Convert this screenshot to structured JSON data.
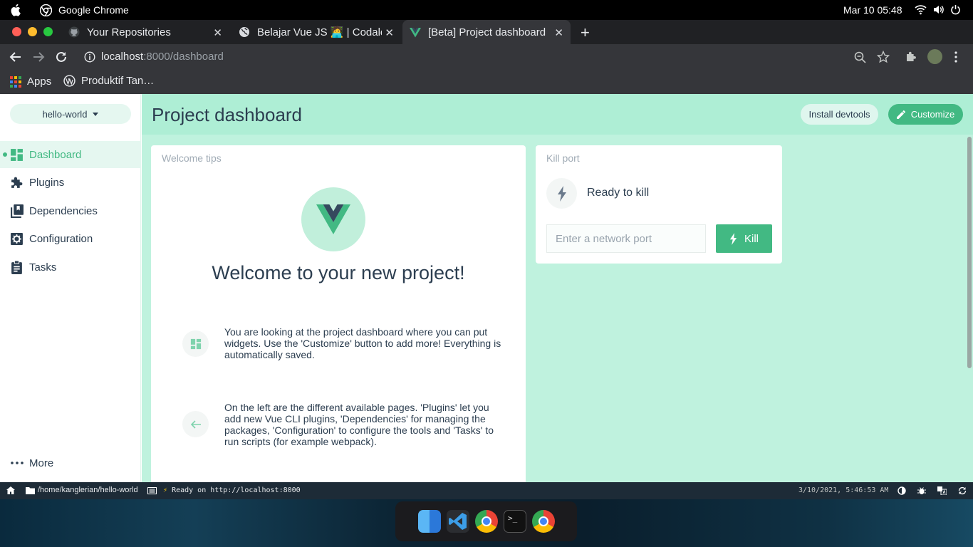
{
  "menubar": {
    "app_name": "Google Chrome",
    "datetime": "Mar 10  05:48"
  },
  "tabs": [
    {
      "label": "Your Repositories",
      "icon": "github-icon",
      "active": false
    },
    {
      "label": "Belajar Vue JS 🧑‍💻 | Codale",
      "icon": "globe-icon",
      "active": false
    },
    {
      "label": "[Beta] Project dashboard",
      "icon": "vue-icon",
      "active": true
    }
  ],
  "address": {
    "host": "localhost",
    "path": ":8000/dashboard"
  },
  "bookmarks": [
    {
      "label": "Apps",
      "icon": "apps-grid-icon"
    },
    {
      "label": "Produktif Tan…",
      "icon": "wordpress-icon"
    }
  ],
  "sidebar": {
    "project": "hello-world",
    "items": [
      {
        "label": "Dashboard",
        "icon": "dashboard-icon",
        "active": true
      },
      {
        "label": "Plugins",
        "icon": "puzzle-icon",
        "active": false
      },
      {
        "label": "Dependencies",
        "icon": "library-icon",
        "active": false
      },
      {
        "label": "Configuration",
        "icon": "settings-icon",
        "active": false
      },
      {
        "label": "Tasks",
        "icon": "clipboard-icon",
        "active": false
      }
    ],
    "more": "More"
  },
  "header": {
    "title": "Project dashboard",
    "devtools_label": "Install devtools",
    "customize_label": "Customize"
  },
  "welcome": {
    "title": "Welcome tips",
    "heading": "Welcome to your new project!",
    "tips": [
      {
        "icon": "dashboard-icon",
        "text": "You are looking at the project dashboard where you can put widgets. Use the 'Customize' button to add more! Everything is automatically saved."
      },
      {
        "icon": "arrow-left-icon",
        "text": "On the left are the different available pages. 'Plugins' let you add new Vue CLI plugins, 'Dependencies' for managing the packages, 'Configuration' to configure the tools and 'Tasks' to run scripts (for example webpack)."
      }
    ]
  },
  "kill_port": {
    "title": "Kill port",
    "status": "Ready to kill",
    "placeholder": "Enter a network port",
    "button_label": "Kill"
  },
  "statusbar": {
    "path": "/home/kanglerian/hello-world",
    "log": "Ready on http://localhost:8000",
    "timestamp": "3/10/2021, 5:46:53 AM"
  },
  "colors": {
    "accent": "#42b983",
    "main_bg": "#bff2de",
    "header_bg": "#aeeed5",
    "text": "#2c3e50"
  }
}
